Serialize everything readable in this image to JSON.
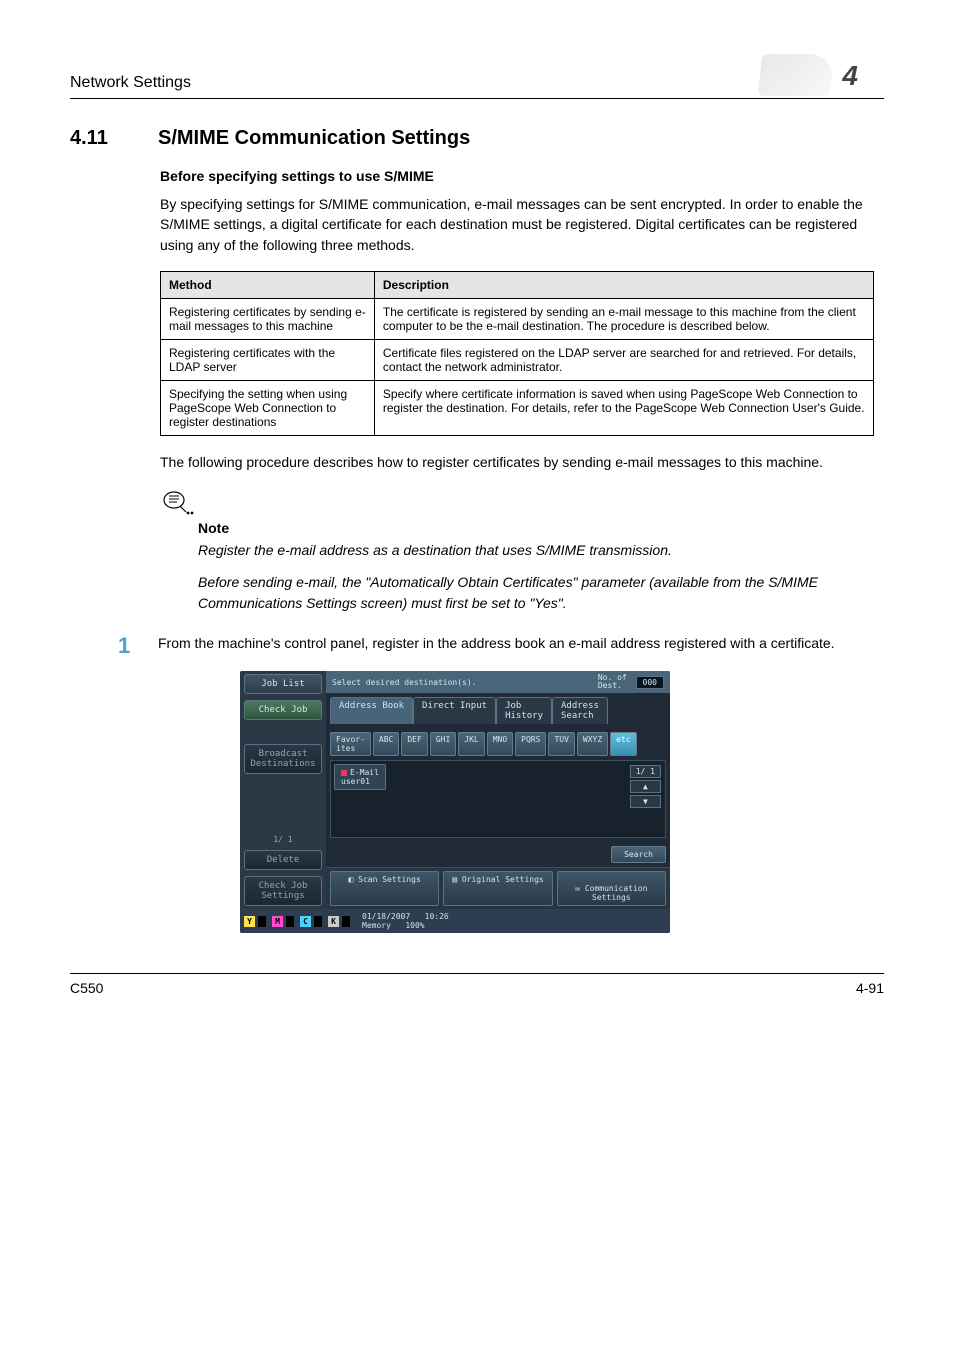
{
  "header": {
    "section_label": "Network Settings",
    "chapter_num": "4"
  },
  "section": {
    "num": "4.11",
    "title": "S/MIME Communication Settings"
  },
  "subhead": "Before specifying settings to use S/MIME",
  "intro": "By specifying settings for S/MIME communication, e-mail messages can be sent encrypted. In order to enable the S/MIME settings, a digital certificate for each destination must be registered. Digital certificates can be registered using any of the following three methods.",
  "table": {
    "headers": [
      "Method",
      "Description"
    ],
    "rows": [
      {
        "method": "Registering certificates by sending e-mail messages to this machine",
        "desc": "The certificate is registered by sending an e-mail message to this machine from the client computer to be the e-mail destination. The procedure is described below."
      },
      {
        "method": "Registering certificates with the LDAP server",
        "desc": "Certificate files registered on the LDAP server are searched for and retrieved. For details, contact the network administrator."
      },
      {
        "method": "Specifying the setting when using PageScope Web Connection to register destinations",
        "desc": "Specify where certificate information is saved when using PageScope Web Connection to register the destination. For details, refer to the PageScope Web Connection User's Guide."
      }
    ]
  },
  "after_table": "The following procedure describes how to register certificates by sending e-mail messages to this machine.",
  "note": {
    "head": "Note",
    "p1": "Register the e-mail address as a destination that uses S/MIME transmission.",
    "p2": "Before sending e-mail, the \"Automatically Obtain Certificates\" parameter (available from the S/MIME Communications Settings screen) must first be set to \"Yes\"."
  },
  "step1": {
    "num": "1",
    "text": "From the machine's control panel, register in the address book an e-mail address registered with a certificate."
  },
  "panel": {
    "side": {
      "job_list": "Job List",
      "check_job": "Check Job",
      "broadcast": "Broadcast\nDestinations",
      "page": "1/ 1",
      "delete": "Delete",
      "check_job_settings": "Check Job\nSettings"
    },
    "topbar": {
      "prompt": "Select desired destination(s).",
      "nod_label": "No. of\nDest.",
      "nod_value": "000"
    },
    "tabs": {
      "address_book": "Address Book",
      "direct_input": "Direct Input",
      "job_history": "Job\nHistory",
      "addr_search": "Address\nSearch"
    },
    "keys": [
      "Favor-\nites",
      "ABC",
      "DEF",
      "GHI",
      "JKL",
      "MNO",
      "PQRS",
      "TUV",
      "WXYZ",
      "etc"
    ],
    "entry": {
      "type": "E-Mail",
      "name": "user01"
    },
    "pager": "1/ 1",
    "search": "Search",
    "func": {
      "scan": "Scan Settings",
      "orig": "Original Settings",
      "comm": "Communication\nSettings"
    },
    "status": {
      "date": "01/18/2007",
      "time": "10:26",
      "mem_label": "Memory",
      "mem_value": "100%"
    },
    "toner": {
      "y": "Y",
      "m": "M",
      "c": "C",
      "k": "K"
    }
  },
  "footer": {
    "model": "C550",
    "page": "4-91"
  }
}
